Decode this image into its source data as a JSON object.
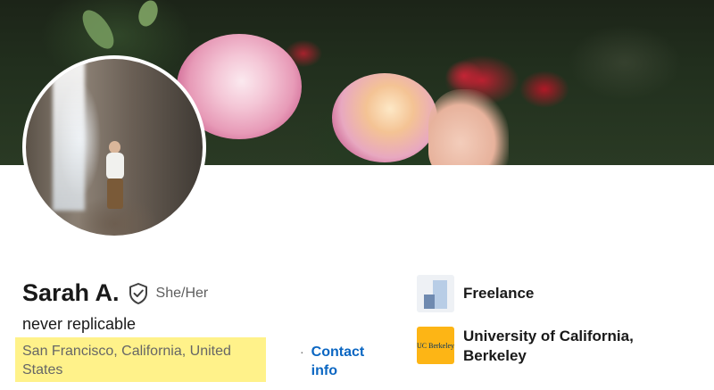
{
  "profile": {
    "name": "Sarah A.",
    "pronouns": "She/Her",
    "headline": "never replicable",
    "location": "San Francisco, California, United States",
    "contact_separator": "·",
    "contact_label": "Contact info"
  },
  "icons": {
    "verified": "verified-shield-icon",
    "freelance_logo": "freelance-logo-icon",
    "berkeley_logo": "uc-berkeley-logo-icon"
  },
  "organizations": [
    {
      "name": "Freelance",
      "logo_text": ""
    },
    {
      "name": "University of California, Berkeley",
      "logo_text": "UC Berkeley"
    }
  ],
  "colors": {
    "link": "#0a66c2",
    "highlight": "#fff28a",
    "berkeley_gold": "#fdb515",
    "berkeley_blue": "#003262"
  }
}
